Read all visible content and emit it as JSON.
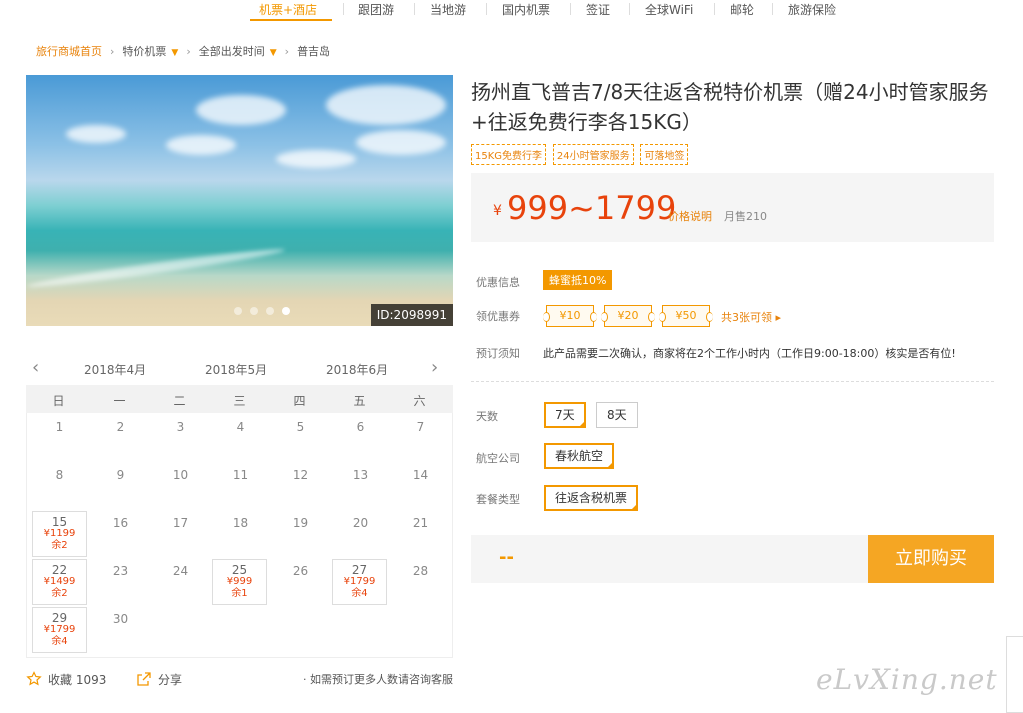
{
  "nav": {
    "items": [
      "机票+酒店",
      "跟团游",
      "当地游",
      "国内机票",
      "签证",
      "全球WiFi",
      "邮轮",
      "旅游保险"
    ],
    "active_color": "#f39800"
  },
  "breadcrumb": {
    "home": "旅行商城首页",
    "level2": "特价机票",
    "level3": "全部出发时间",
    "current": "普吉岛"
  },
  "hero": {
    "image_id": "ID:2098991",
    "slides": 4,
    "active_slide": 4
  },
  "calendar": {
    "months": [
      "2018年4月",
      "2018年5月",
      "2018年6月"
    ],
    "weekdays": [
      "日",
      "一",
      "二",
      "三",
      "四",
      "五",
      "六"
    ],
    "days": [
      "1",
      "2",
      "3",
      "4",
      "5",
      "6",
      "7",
      "8",
      "9",
      "10",
      "11",
      "12",
      "13",
      "14",
      "15",
      "16",
      "17",
      "18",
      "19",
      "20",
      "21",
      "22",
      "23",
      "24",
      "25",
      "26",
      "27",
      "28",
      "29",
      "30"
    ],
    "priced": [
      {
        "day": "15",
        "price": "¥1199",
        "stock": "余2"
      },
      {
        "day": "22",
        "price": "¥1499",
        "stock": "余2"
      },
      {
        "day": "25",
        "price": "¥999",
        "stock": "余1"
      },
      {
        "day": "27",
        "price": "¥1799",
        "stock": "余4"
      },
      {
        "day": "29",
        "price": "¥1799",
        "stock": "余4"
      }
    ]
  },
  "actions": {
    "favorite": "收藏 1093",
    "share": "分享",
    "consult": "· 如需预订更多人数请咨询客服"
  },
  "product": {
    "title": "扬州直飞普吉7/8天往返含税特价机票（赠24小时管家服务+往返免费行李各15KG）",
    "tags": [
      "15KG免费行李",
      "24小时管家服务",
      "可落地签"
    ],
    "currency": "¥",
    "price": "999~1799",
    "price_note": "价格说明",
    "sold": "月售210"
  },
  "promo": {
    "label": "优惠信息",
    "badge": "蜂蜜抵10%",
    "coupon_label": "领优惠券",
    "coupons": [
      "¥10",
      "¥20",
      "¥50"
    ],
    "coupon_more": "共3张可领 ▸",
    "notice_label": "预订须知",
    "notice": "此产品需要二次确认，商家将在2个工作小时内（工作日9:00-18:00）核实是否有位!"
  },
  "options": {
    "days_label": "天数",
    "days": [
      "7天",
      "8天"
    ],
    "airline_label": "航空公司",
    "airline": "春秋航空",
    "package_label": "套餐类型",
    "package": "往返含税机票"
  },
  "buy": {
    "total": "--",
    "button": "立即购买"
  },
  "watermark": "eLvXing.net",
  "colors": {
    "accent": "#f39800",
    "price": "#e8430c"
  }
}
